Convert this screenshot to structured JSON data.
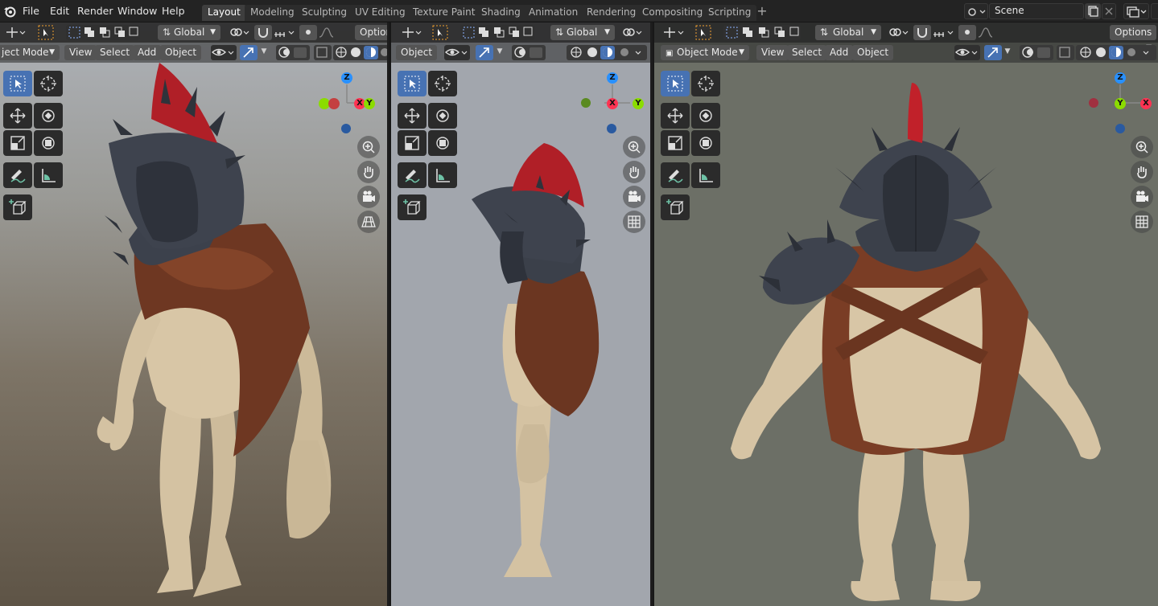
{
  "menu": [
    "File",
    "Edit",
    "Render",
    "Window",
    "Help"
  ],
  "workspaces": [
    "Layout",
    "Modeling",
    "Sculpting",
    "UV Editing",
    "Texture Paint",
    "Shading",
    "Animation",
    "Rendering",
    "Compositing",
    "Scripting"
  ],
  "active_workspace": "Layout",
  "scene": "Scene",
  "viewport_left": {
    "transform_orientation": "Global",
    "options_label": "Option",
    "mode": "ject Mode",
    "menus": [
      "View",
      "Select",
      "Add",
      "Object"
    ],
    "gizmo": {
      "z": "Z",
      "x": "X",
      "y": "Y"
    },
    "background": "#9ea2a6"
  },
  "viewport_middle": {
    "transform_orientation": "Global",
    "object_menu": "Object",
    "gizmo": {
      "z": "Z",
      "x": "X",
      "y": "Y"
    }
  },
  "viewport_right": {
    "transform_orientation": "Global",
    "options_label": "Options",
    "mode": "Object Mode",
    "menus": [
      "View",
      "Select",
      "Add",
      "Object"
    ],
    "gizmo": {
      "z": "Z",
      "x": "X",
      "y": "Y"
    }
  },
  "colors": {
    "accent": "#4772b3",
    "axis_x": "#ff3352",
    "axis_y": "#8bdc00",
    "axis_z": "#2890ff",
    "skin": "#d9c7a8",
    "cape": "#7a3d25",
    "armor": "#3f4450",
    "plume": "#b8232a"
  }
}
